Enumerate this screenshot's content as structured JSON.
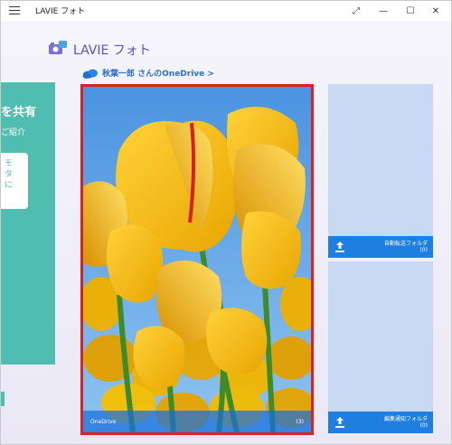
{
  "window": {
    "title": "LAVIE フォト",
    "controls": {
      "expand": "⤢",
      "minimize": "—",
      "maximize": "☐",
      "close": "✕"
    }
  },
  "header": {
    "title": "LAVIE フォト",
    "onedrive_link": "秋葉一郎 さんのOneDrive >"
  },
  "left_panel": {
    "share_title": "を共有",
    "share_subtitle": "ご紹介",
    "card_lines": [
      "モ",
      "タ",
      "に"
    ]
  },
  "main_tile": {
    "caption": "OneDrive",
    "count": "(3)",
    "highlight_color": "#e02020"
  },
  "folders": [
    {
      "name": "自動転送フォルダ",
      "count": "(0)"
    },
    {
      "name": "編集通知フォルダ",
      "count": "(0)"
    }
  ],
  "colors": {
    "accent": "#5b4fc6",
    "link": "#2b6fd6",
    "teal": "#4fbdb0",
    "folder_bar": "#1f7fe0"
  }
}
